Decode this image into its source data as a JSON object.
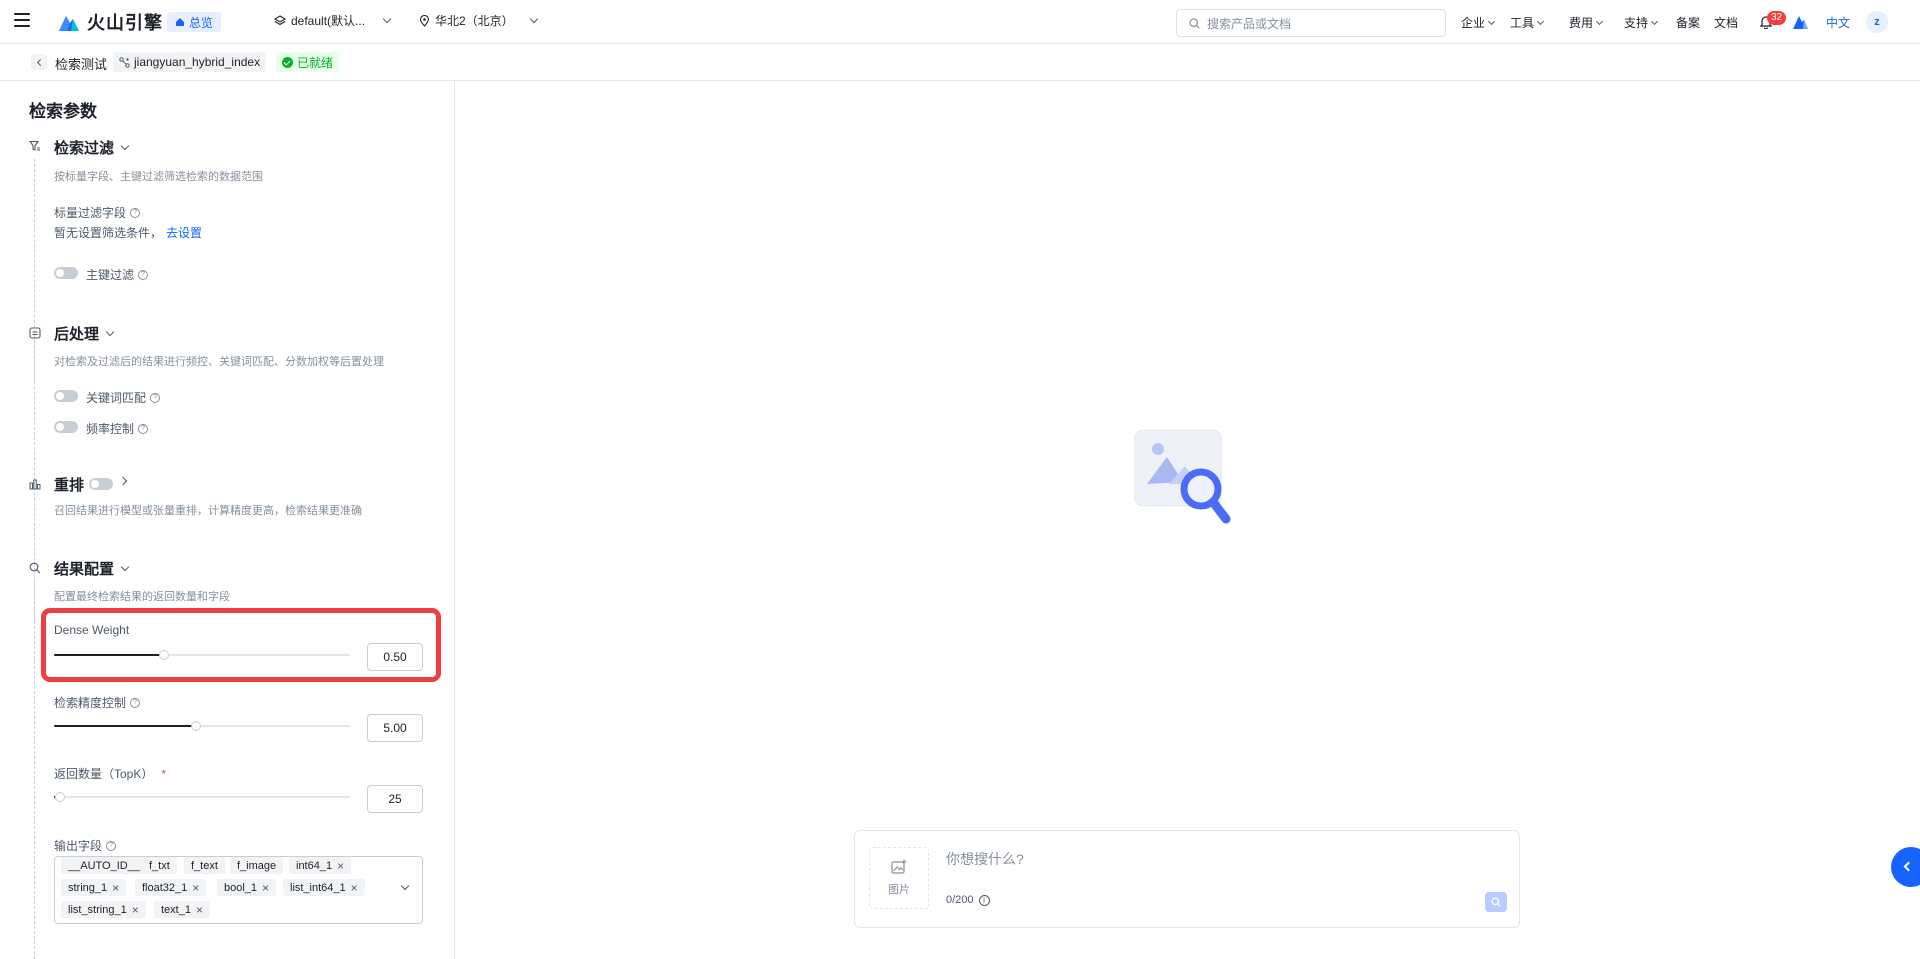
{
  "header": {
    "brand": "火山引擎",
    "overview_label": "总览",
    "project_select": "default(默认...",
    "region_select": "华北2（北京）",
    "search_placeholder": "搜索产品或文档",
    "nav": [
      {
        "label": "企业"
      },
      {
        "label": "工具"
      },
      {
        "label": "费用"
      },
      {
        "label": "支持"
      },
      {
        "label": "备案"
      },
      {
        "label": "文档"
      }
    ],
    "notification_count": "32",
    "language": "中文",
    "user_initial": "z"
  },
  "breadcrumb": {
    "page": "检索测试",
    "index_name": "jiangyuan_hybrid_index",
    "status": "已就绪"
  },
  "panel": {
    "title": "检索参数",
    "filter": {
      "title": "检索过滤",
      "desc": "按标量字段、主键过滤筛选检索的数据范围",
      "scalar_label": "标量过滤字段",
      "scalar_empty": "暂无设置筛选条件，",
      "scalar_link": "去设置",
      "pk_label": "主键过滤",
      "pk_enabled": false
    },
    "post": {
      "title": "后处理",
      "desc": "对检索及过滤后的结果进行频控、关键词匹配、分数加权等后置处理",
      "keyword_label": "关键词匹配",
      "keyword_enabled": false,
      "freq_label": "频率控制",
      "freq_enabled": false
    },
    "rerank": {
      "title": "重排",
      "enabled": false,
      "desc": "召回结果进行模型或张量重排，计算精度更高，检索结果更准确"
    },
    "result": {
      "title": "结果配置",
      "desc": "配置最终检索结果的返回数量和字段",
      "dense_weight": {
        "label": "Dense Weight",
        "value": "0.50",
        "fraction": 0.37
      },
      "precision": {
        "label": "检索精度控制",
        "value": "5.00",
        "fraction": 0.48
      },
      "topk": {
        "label": "返回数量（TopK）",
        "value": "25",
        "fraction": 0.02
      },
      "output_label": "输出字段",
      "output_fields": [
        {
          "label": "__AUTO_ID__",
          "removable": false
        },
        {
          "label": "f_txt",
          "removable": false
        },
        {
          "label": "f_text",
          "removable": false
        },
        {
          "label": "f_image",
          "removable": false
        },
        {
          "label": "int64_1",
          "removable": true
        },
        {
          "label": "string_1",
          "removable": true
        },
        {
          "label": "float32_1",
          "removable": true
        },
        {
          "label": "bool_1",
          "removable": true
        },
        {
          "label": "list_int64_1",
          "removable": true
        },
        {
          "label": "list_string_1",
          "removable": true
        },
        {
          "label": "text_1",
          "removable": true
        }
      ]
    }
  },
  "query": {
    "image_label": "图片",
    "placeholder": "你想搜什么?",
    "counter": "0/200"
  },
  "colors": {
    "accent": "#1664ff",
    "highlight": "#ef3e42",
    "success": "#00b42a"
  }
}
